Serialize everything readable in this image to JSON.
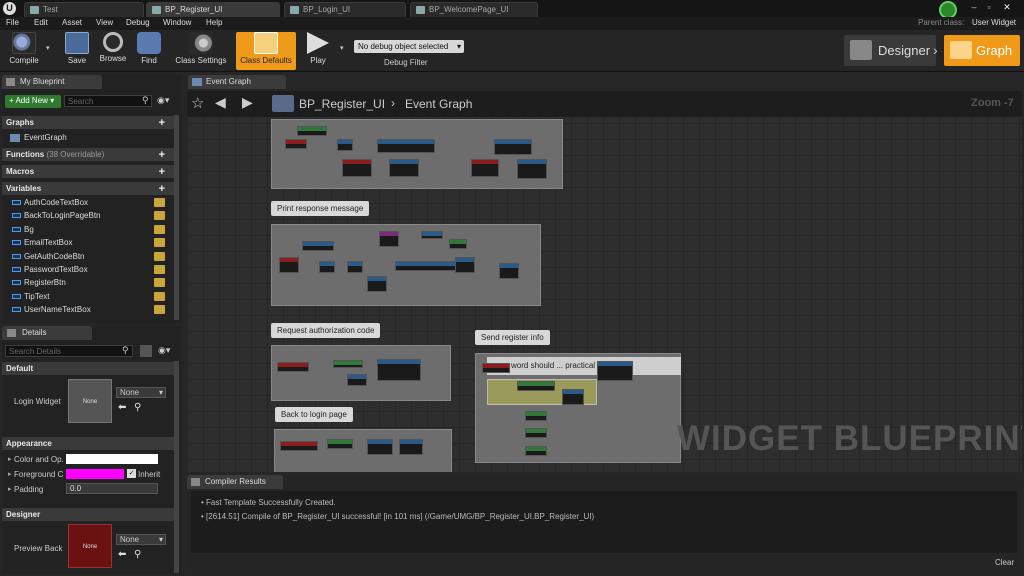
{
  "tabs": [
    {
      "label": "Test"
    },
    {
      "label": "BP_Register_UI"
    },
    {
      "label": "BP_Login_UI"
    },
    {
      "label": "BP_WelcomePage_UI"
    }
  ],
  "parent_class": {
    "label": "Parent class:",
    "value": "User Widget"
  },
  "menu": [
    "File",
    "Edit",
    "Asset",
    "View",
    "Debug",
    "Window",
    "Help"
  ],
  "toolbar": {
    "compile": "Compile",
    "save": "Save",
    "browse": "Browse",
    "find": "Find",
    "class_settings": "Class Settings",
    "class_defaults": "Class Defaults",
    "play": "Play",
    "debug_select": "No debug object selected",
    "debug_filter": "Debug Filter",
    "designer": "Designer",
    "graph": "Graph"
  },
  "my_blueprint": {
    "tab": "My Blueprint",
    "add_new": "Add New",
    "search_placeholder": "Search",
    "graphs": "Graphs",
    "event_graph": "EventGraph",
    "functions": "Functions",
    "functions_count": "(38 Overridable)",
    "macros": "Macros",
    "variables": "Variables",
    "vars": [
      "AuthCodeTextBox",
      "BackToLoginPageBtn",
      "Bg",
      "EmailTextBox",
      "GetAuthCodeBtn",
      "PasswordTextBox",
      "RegisterBtn",
      "TipText",
      "UserNameTextBox"
    ]
  },
  "details": {
    "tab": "Details",
    "search_placeholder": "Search Details",
    "default": "Default",
    "login_widget": "Login Widget",
    "none": "None",
    "appearance": "Appearance",
    "color_opacity": "Color and Op.",
    "foreground": "Foreground C",
    "inherit": "Inherit",
    "padding": "Padding",
    "padding_value": "0.0",
    "designer": "Designer",
    "preview_back": "Preview Back"
  },
  "graph": {
    "tab": "Event Graph",
    "breadcrumb_bp": "BP_Register_UI",
    "breadcrumb_graph": "Event Graph",
    "zoom": "Zoom -7",
    "watermark": "WIDGET BLUEPRINT",
    "comments": [
      "Print response message",
      "Request authorization code",
      "Back to login page",
      "Send register info",
      "word should ... practical use"
    ]
  },
  "compiler": {
    "tab": "Compiler Results",
    "lines": [
      "Fast Template Successfully Created.",
      "[2614.51] Compile of BP_Register_UI successful! [in 101 ms] (/Game/UMG/BP_Register_UI.BP_Register_UI)"
    ],
    "clear": "Clear"
  },
  "colors": {
    "accent": "#f09a1a",
    "pink": "#ff00ff",
    "exec": "#ffffff",
    "bool": "#8b0000"
  }
}
